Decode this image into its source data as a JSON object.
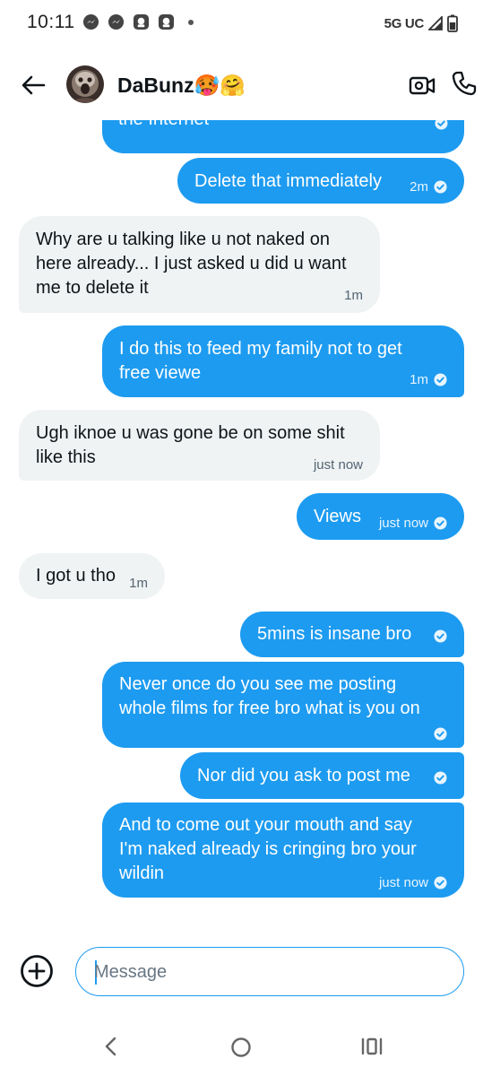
{
  "status_bar": {
    "time": "10:11",
    "network": "5G UC"
  },
  "header": {
    "contact_name": "DaBunz🥵🤗"
  },
  "messages": [
    {
      "id": "m1",
      "direction": "out",
      "lines": [
        "the Internet"
      ],
      "time": "",
      "read": true
    },
    {
      "id": "m2",
      "direction": "out",
      "lines": [
        "Delete that immediately"
      ],
      "time": "2m",
      "read": true
    },
    {
      "id": "m3",
      "direction": "in",
      "lines": [
        "Why are u talking like u not naked on",
        "here already... I just asked u did u want",
        "me to delete it"
      ],
      "time": "1m"
    },
    {
      "id": "m4",
      "direction": "out",
      "lines": [
        "I do this to feed my family not to get",
        "free viewe"
      ],
      "time": "1m",
      "read": true
    },
    {
      "id": "m5",
      "direction": "in",
      "lines": [
        "Ugh iknoe u was gone be on some shit",
        "like this"
      ],
      "time": "just now"
    },
    {
      "id": "m6",
      "direction": "out",
      "lines": [
        "Views"
      ],
      "time": "just now",
      "read": true
    },
    {
      "id": "m7",
      "direction": "in",
      "lines": [
        "I got u tho"
      ],
      "time": "1m"
    },
    {
      "id": "m8",
      "direction": "out",
      "lines": [
        "5mins is insane bro"
      ],
      "time": "",
      "read": true
    },
    {
      "id": "m9",
      "direction": "out",
      "lines": [
        "Never once do you see me posting",
        "whole films for free bro what is you on"
      ],
      "time": "",
      "read": true
    },
    {
      "id": "m10",
      "direction": "out",
      "lines": [
        "Nor did you ask to post me"
      ],
      "time": "",
      "read": true
    },
    {
      "id": "m11",
      "direction": "out",
      "lines": [
        "And to come out your mouth and say",
        "I'm naked already is cringing bro your",
        "wildin"
      ],
      "time": "just now",
      "read": true
    }
  ],
  "composer": {
    "placeholder": "Message"
  },
  "icons": {
    "back": "arrow-left-icon",
    "video": "video-camera-icon",
    "call": "phone-icon",
    "add": "plus-circle-icon",
    "read_receipt": "check-circle-icon"
  },
  "colors": {
    "outgoing_bubble": "#1d9bf0",
    "incoming_bubble": "#eff3f4",
    "accent": "#1d9bf0"
  }
}
